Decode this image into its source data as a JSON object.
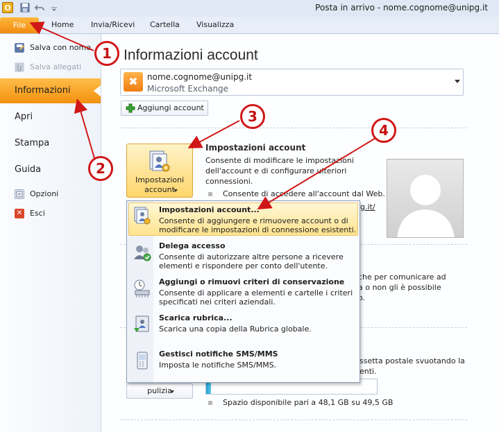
{
  "window": {
    "title": "Posta in arrivo - nome.cognome@unipg.it",
    "app_icon": "outlook-icon",
    "quick_access": [
      "save-icon",
      "undo-icon",
      "customize-icon"
    ]
  },
  "ribbon": {
    "tabs": [
      "File",
      "Home",
      "Invia/Ricevi",
      "Cartella",
      "Visualizza"
    ]
  },
  "backstage": {
    "save_as": "Salva con nome",
    "save_attachments": "Salva allegati",
    "info": "Informazioni",
    "open": "Apri",
    "print": "Stampa",
    "help": "Guida",
    "options": "Opzioni",
    "exit": "Esci"
  },
  "main": {
    "title": "Informazioni account",
    "account": {
      "email": "nome.cognome@unipg.it",
      "type": "Microsoft Exchange"
    },
    "add_account": "Aggiungi account",
    "settings_button": {
      "line1": "Impostazioni",
      "line2": "account"
    },
    "settings_section": {
      "title": "Impostazioni account",
      "desc1": "Consente di modificare le impostazioni",
      "desc2": "dell'account e di configurare ulteriori",
      "desc3": "connessioni.",
      "bullet": "Consente di accedere all'account dal Web.",
      "link_partial": "g.it/"
    },
    "oof_partial": {
      "line1": "che per comunicare ad",
      "line2": "a o non gli è possibile",
      "line3": "o."
    },
    "cleanup_partial": {
      "line1": "ssetta postale svuotando la",
      "line2": "enti."
    },
    "cleanup_button": "pulizia",
    "storage": {
      "free_text": "Spazio disponibile pari a 48,1 GB su 49,5 GB",
      "free_gb": 48.1,
      "total_gb": 49.5
    }
  },
  "menu": {
    "items": [
      {
        "title": "Impostazioni account...",
        "desc1": "Consente di aggiungere e rimuovere account o di",
        "desc2": "modificare le impostazioni di connessione esistenti.",
        "icon": "account-settings-icon"
      },
      {
        "title": "Delega accesso",
        "desc1": "Consente di autorizzare altre persone a ricevere",
        "desc2": "elementi e rispondere per conto dell'utente.",
        "icon": "delegate-access-icon"
      },
      {
        "title": "Aggiungi o rimuovi criteri di conservazione",
        "desc1": "Consente di applicare a elementi e cartelle i criteri",
        "desc2": "specificati nei criteri aziendali.",
        "icon": "retention-policy-icon"
      },
      {
        "title": "Scarica rubrica...",
        "desc1": "Scarica una copia della Rubrica globale.",
        "desc2": "",
        "icon": "download-address-book-icon"
      },
      {
        "title": "Gestisci notifiche SMS/MMS",
        "desc1": "Imposta le notifiche SMS/MMS.",
        "desc2": "",
        "icon": "sms-notifications-icon"
      }
    ]
  },
  "callouts": [
    "1",
    "2",
    "3",
    "4"
  ],
  "colors": {
    "accent_orange": "#f3900f",
    "callout_red": "#d01717",
    "highlight": "#ffe38e"
  }
}
